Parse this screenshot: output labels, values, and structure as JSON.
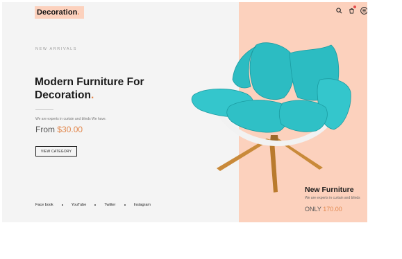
{
  "header": {
    "logo_text": "Decoration",
    "logo_dot": ".",
    "icons": [
      "search-icon",
      "cart-icon",
      "menu-icon"
    ]
  },
  "hero": {
    "eyebrow": "NEW ARRIVALS",
    "headline_line1": "Modern Furniture For",
    "headline_line2": "Decoration",
    "headline_dot": ".",
    "description": "We are experts in curtain and blinds We have.",
    "price_label": "From ",
    "price_value": "$30.00",
    "cta_label": "VIEW CATEGORY"
  },
  "social": [
    "Face book",
    "YouTube",
    "Twitter",
    "Instagram"
  ],
  "feature_card": {
    "title": "New Furniture",
    "description": "We are experts in curtain and blinds",
    "price_label": "ONLY ",
    "price_value": "170.00"
  },
  "colors": {
    "accent": "#e2884e",
    "peach_panel": "#fcd1bd",
    "chair_teal": "#2cbcc2"
  }
}
